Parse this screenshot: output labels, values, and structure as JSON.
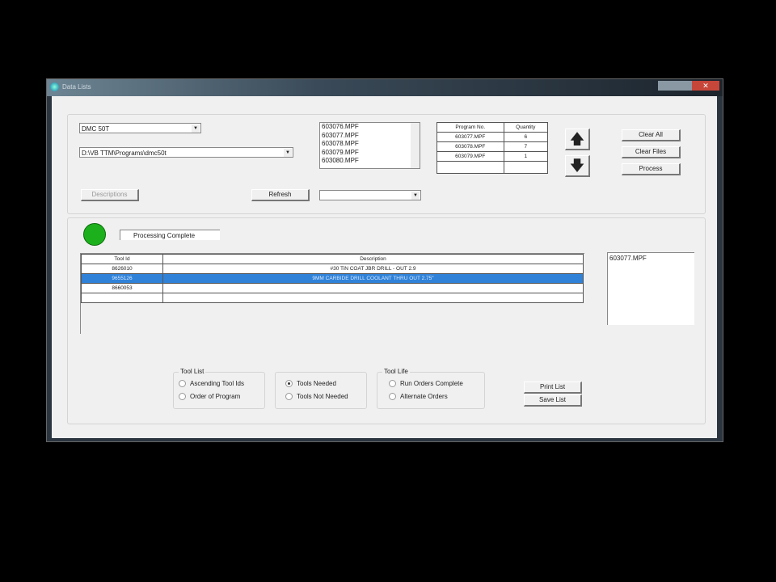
{
  "window": {
    "title": "Data Lists"
  },
  "machine_select": {
    "value": "DMC 50T"
  },
  "path_select": {
    "value": "D:\\VB TTM\\Programs\\dmc50t"
  },
  "file_list": [
    "603076.MPF",
    "603077.MPF",
    "603078.MPF",
    "603079.MPF",
    "603080.MPF"
  ],
  "buttons": {
    "descriptions": "Descriptions",
    "refresh": "Refresh",
    "clear_all": "Clear All",
    "clear_files": "Clear Files",
    "process": "Process",
    "print_list": "Print List",
    "save_list": "Save List"
  },
  "extra_select": {
    "value": ""
  },
  "program_table": {
    "headers": [
      "Program No.",
      "Quantity"
    ],
    "rows": [
      [
        "603077.MPF",
        "6"
      ],
      [
        "603078.MPF",
        "7"
      ],
      [
        "603079.MPF",
        "1"
      ],
      [
        "",
        ""
      ]
    ]
  },
  "status": {
    "text": "Processing Complete",
    "color": "#1db01d"
  },
  "tool_table": {
    "headers": [
      "Tool Id",
      "Description"
    ],
    "rows": [
      [
        "8626010",
        "#30 TiN COAT JBR DRILL - OUT 2.9"
      ],
      [
        "9655126",
        "9MM CARBIDE DRILL COOLANT THRU OUT 2.75\""
      ],
      [
        "8660053",
        ""
      ],
      [
        "",
        ""
      ]
    ],
    "selected_index": 1
  },
  "side_list": [
    "603077.MPF"
  ],
  "tool_list_group": {
    "title": "Tool List",
    "options": [
      "Ascending Tool Ids",
      "Order of Program"
    ],
    "selected": null
  },
  "needed_group": {
    "options": [
      "Tools Needed",
      "Tools Not Needed"
    ],
    "selected": 0
  },
  "tool_life_group": {
    "title": "Tool Life",
    "options": [
      "Run Orders Complete",
      "Alternate Orders"
    ],
    "selected": null
  }
}
